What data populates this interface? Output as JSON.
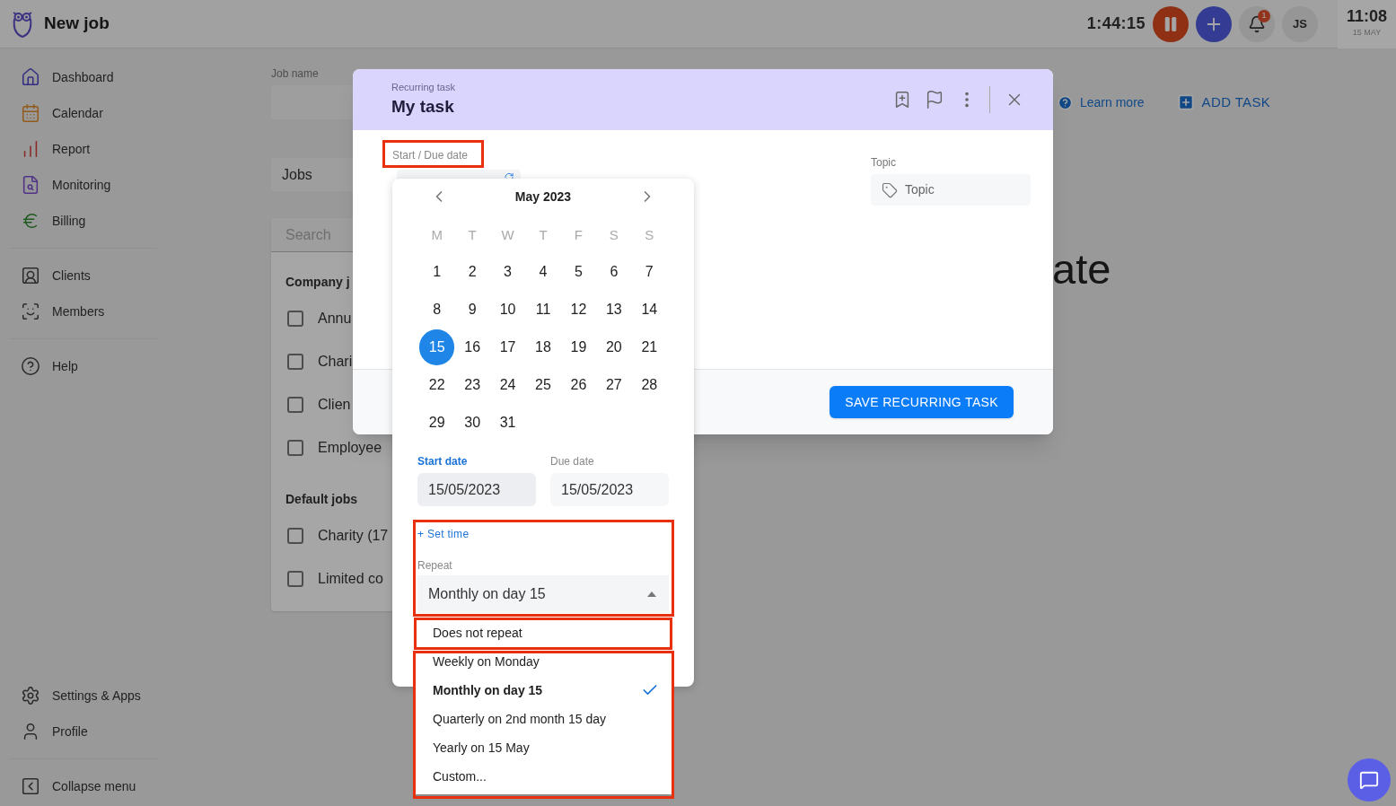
{
  "app": {
    "title": "New job",
    "timer": "1:44:15",
    "notifications": "1",
    "avatar": "JS",
    "clock": {
      "time": "11:08",
      "date": "15 MAY"
    }
  },
  "sidebar": {
    "main_items": [
      {
        "label": "Dashboard"
      },
      {
        "label": "Calendar"
      },
      {
        "label": "Report"
      },
      {
        "label": "Monitoring"
      },
      {
        "label": "Billing"
      }
    ],
    "people_items": [
      {
        "label": "Clients"
      },
      {
        "label": "Members"
      }
    ],
    "help": "Help",
    "bottom_items": [
      {
        "label": "Settings & Apps"
      },
      {
        "label": "Profile"
      }
    ],
    "collapse": "Collapse menu"
  },
  "page": {
    "job_name_label": "Job name",
    "jobs_field": "Jobs",
    "search_placeholder": "Search",
    "heading_fragment": "ate",
    "learn_more": "Learn more",
    "add_task": "ADD TASK",
    "groups": [
      {
        "title": "Company j",
        "items": [
          {
            "label": "Annu",
            "checked": false
          },
          {
            "label": "Chari",
            "checked": false
          },
          {
            "label": "Clien",
            "checked": false
          },
          {
            "label": "Employee",
            "checked": false
          }
        ]
      },
      {
        "title": "Default jobs",
        "items": [
          {
            "label": "Charity (17",
            "checked": false
          },
          {
            "label": "Limited co",
            "checked": false
          }
        ]
      }
    ]
  },
  "modal": {
    "kicker": "Recurring task",
    "title": "My task",
    "date_label": "Start / Due date",
    "topic": {
      "label": "Topic",
      "placeholder": "Topic"
    },
    "save": "SAVE RECURRING TASK"
  },
  "calendar": {
    "month": "May 2023",
    "weekdays": [
      "M",
      "T",
      "W",
      "T",
      "F",
      "S",
      "S"
    ],
    "days": [
      {
        "label": "1",
        "selected": false
      },
      {
        "label": "2",
        "selected": false
      },
      {
        "label": "3",
        "selected": false
      },
      {
        "label": "4",
        "selected": false
      },
      {
        "label": "5",
        "selected": false
      },
      {
        "label": "6",
        "selected": false
      },
      {
        "label": "7",
        "selected": false
      },
      {
        "label": "8",
        "selected": false
      },
      {
        "label": "9",
        "selected": false
      },
      {
        "label": "10",
        "selected": false
      },
      {
        "label": "11",
        "selected": false
      },
      {
        "label": "12",
        "selected": false
      },
      {
        "label": "13",
        "selected": false
      },
      {
        "label": "14",
        "selected": false
      },
      {
        "label": "15",
        "selected": true
      },
      {
        "label": "16",
        "selected": false
      },
      {
        "label": "17",
        "selected": false
      },
      {
        "label": "18",
        "selected": false
      },
      {
        "label": "19",
        "selected": false
      },
      {
        "label": "20",
        "selected": false
      },
      {
        "label": "21",
        "selected": false
      },
      {
        "label": "22",
        "selected": false
      },
      {
        "label": "23",
        "selected": false
      },
      {
        "label": "24",
        "selected": false
      },
      {
        "label": "25",
        "selected": false
      },
      {
        "label": "26",
        "selected": false
      },
      {
        "label": "27",
        "selected": false
      },
      {
        "label": "28",
        "selected": false
      },
      {
        "label": "29",
        "selected": false
      },
      {
        "label": "30",
        "selected": false
      },
      {
        "label": "31",
        "selected": false
      }
    ],
    "start": {
      "label": "Start date",
      "value": "15/05/2023",
      "focused": true
    },
    "due": {
      "label": "Due date",
      "value": "15/05/2023",
      "focused": false
    },
    "set_time": "+ Set time",
    "repeat": {
      "label": "Repeat",
      "value": "Monthly on day 15",
      "expanded": true,
      "options": [
        {
          "label": "Does not repeat",
          "selected": false
        },
        {
          "label": "Weekly on Monday",
          "selected": false
        },
        {
          "label": "Monthly on day 15",
          "selected": true
        },
        {
          "label": "Quarterly on 2nd month 15 day",
          "selected": false
        },
        {
          "label": "Yearly on 15 May",
          "selected": false
        },
        {
          "label": "Custom...",
          "selected": false
        }
      ]
    }
  }
}
